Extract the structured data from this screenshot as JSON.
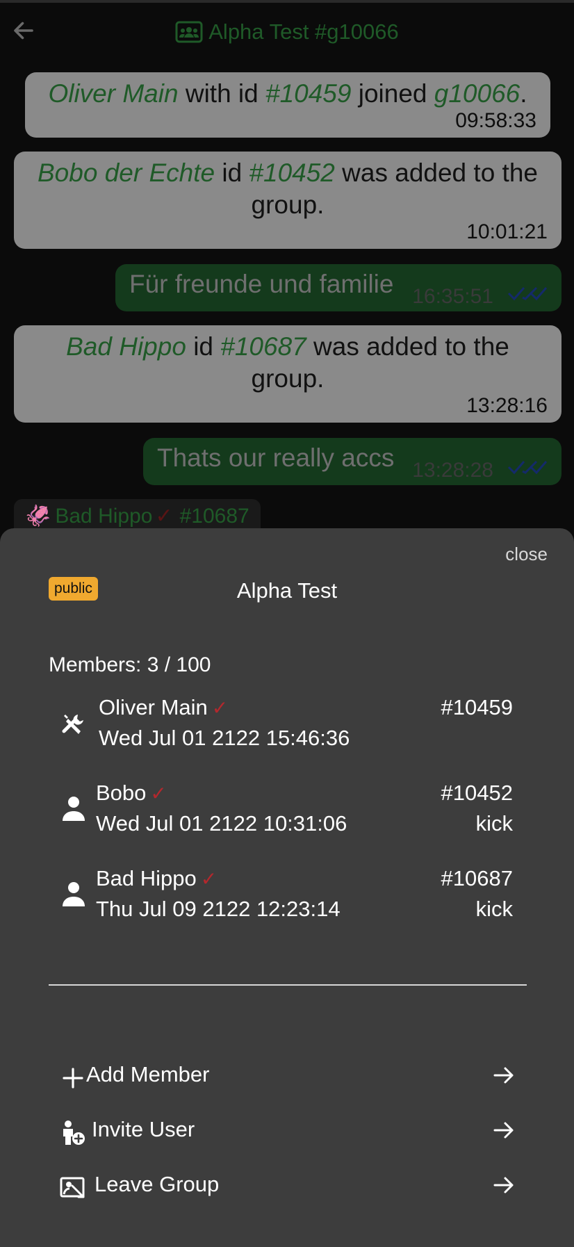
{
  "chat": {
    "title": "Alpha Test #g10066",
    "messages": [
      {
        "kind": "system",
        "parts": [
          "Oliver Main",
          " with id ",
          "#10459",
          " joined ",
          "g10066",
          "."
        ],
        "time": "09:58:33"
      },
      {
        "kind": "system",
        "parts": [
          "Bobo der Echte",
          " id ",
          "#10452",
          " was added to the group."
        ],
        "time": "10:01:21"
      },
      {
        "kind": "own",
        "text": "Für freunde und familie",
        "time": "16:35:51"
      },
      {
        "kind": "system",
        "parts": [
          "Bad Hippo",
          " id ",
          "#10687",
          " was added to the group."
        ],
        "time": "13:28:16"
      },
      {
        "kind": "own",
        "text": "Thats our really accs",
        "time": "13:28:28"
      }
    ],
    "sender_chip": {
      "emoji": "🦑",
      "name": "Bad Hippo",
      "id": "#10687"
    }
  },
  "sheet": {
    "close_label": "close",
    "badge": "public",
    "group_name": "Alpha Test",
    "members_label": "Members: 3 / 100",
    "members": [
      {
        "name": "Oliver Main",
        "date": "Wed Jul 01 2122 15:46:36",
        "id": "#10459",
        "kick": "",
        "role_icon": "admin-tools-icon"
      },
      {
        "name": "Bobo",
        "date": "Wed Jul 01 2122 10:31:06",
        "id": "#10452",
        "kick": "kick",
        "role_icon": "person-icon"
      },
      {
        "name": "Bad Hippo",
        "date": "Thu Jul 09 2122 12:23:14",
        "id": "#10687",
        "kick": "kick",
        "role_icon": "person-icon"
      }
    ],
    "actions": [
      {
        "label": "Add Member",
        "icon": "plus-icon"
      },
      {
        "label": "Invite User",
        "icon": "person-add-icon"
      },
      {
        "label": "Leave Group",
        "icon": "leave-group-icon"
      }
    ]
  },
  "colors": {
    "accent_green": "#1f5a28",
    "check_red": "#b3282d",
    "badge_orange": "#f0a92f",
    "sheet_bg": "#3d3d3d"
  }
}
